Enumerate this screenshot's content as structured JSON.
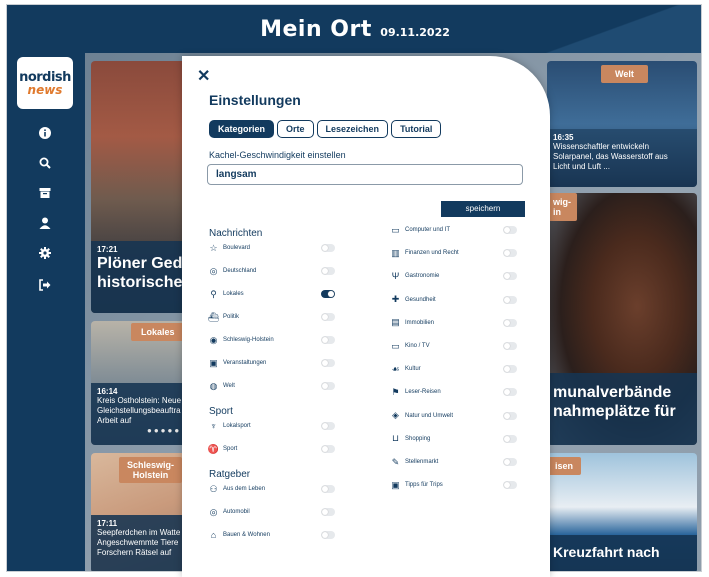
{
  "header": {
    "title": "Mein Ort",
    "date": "09.11.2022"
  },
  "logo": {
    "line1": "nordish",
    "line2": "news"
  },
  "sidebar": {
    "icons": [
      "info-icon",
      "search-icon",
      "archive-icon",
      "user-icon",
      "gear-icon",
      "logout-icon"
    ]
  },
  "tiles": {
    "main": {
      "time": "17:21",
      "headline_line1": "Plöner Ged",
      "headline_line2": "historische"
    },
    "lokales": {
      "category": "Lokales",
      "time": "16:14",
      "text_line1": "Kreis Ostholstein: Neue",
      "text_line2": "Gleichstellungsbeauftra",
      "text_line3": "Arbeit auf"
    },
    "schleswig": {
      "category_line1": "Schleswig-",
      "category_line2": "Holstein",
      "time": "17:11",
      "text_line1": "Seepferdchen im Watte",
      "text_line2": "Angeschwemmte Tiere",
      "text_line3": "Forschern Rätsel auf"
    },
    "welt": {
      "category": "Welt",
      "time": "16:35",
      "text_line1": "Wissenschaftler entwickeln",
      "text_line2": "Solarpanel, das Wasserstoff aus",
      "text_line3": "Licht und Luft ..."
    },
    "woman": {
      "category_line1": "wig-",
      "category_line2": "in",
      "headline_line1": "munalverbände",
      "headline_line2": "nahmeplätze für"
    },
    "ship": {
      "category": "isen",
      "headline": "Kreuzfahrt nach"
    }
  },
  "modal": {
    "close": "✕",
    "title": "Einstellungen",
    "tabs": [
      "Kategorien",
      "Orte",
      "Lesezeichen",
      "Tutorial"
    ],
    "speed_label": "Kachel-Geschwindigkeit einstellen",
    "speed_value": "langsam",
    "save_label": "speichern",
    "left_groups": [
      {
        "title": "Nachrichten",
        "items": [
          {
            "icon": "star-icon",
            "label": "Boulevard",
            "on": false
          },
          {
            "icon": "de-icon",
            "label": "Deutschland",
            "on": false
          },
          {
            "icon": "pin-icon",
            "label": "Lokales",
            "on": true
          },
          {
            "icon": "ship-icon",
            "label": "Politik",
            "on": false
          },
          {
            "icon": "sh-icon",
            "label": "Schleswig-Holstein",
            "on": false
          },
          {
            "icon": "calendar-icon",
            "label": "Veranstaltungen",
            "on": false
          },
          {
            "icon": "globe-icon",
            "label": "Welt",
            "on": false
          }
        ]
      },
      {
        "title": "Sport",
        "items": [
          {
            "icon": "trophy-icon",
            "label": "Lokalsport",
            "on": false
          },
          {
            "icon": "cup-icon",
            "label": "Sport",
            "on": false
          }
        ]
      },
      {
        "title": "Ratgeber",
        "items": [
          {
            "icon": "people-icon",
            "label": "Aus dem Leben",
            "on": false
          },
          {
            "icon": "wheel-icon",
            "label": "Automobil",
            "on": false
          },
          {
            "icon": "house-icon",
            "label": "Bauen & Wohnen",
            "on": false
          }
        ]
      }
    ],
    "right_items": [
      {
        "icon": "monitor-icon",
        "label": "Computer und IT",
        "on": false
      },
      {
        "icon": "chart-icon",
        "label": "Finanzen und Recht",
        "on": false
      },
      {
        "icon": "cutlery-icon",
        "label": "Gastronomie",
        "on": false
      },
      {
        "icon": "cross-icon",
        "label": "Gesundheit",
        "on": false
      },
      {
        "icon": "building-icon",
        "label": "Immobilien",
        "on": false
      },
      {
        "icon": "tv-icon",
        "label": "Kino / TV",
        "on": false
      },
      {
        "icon": "culture-icon",
        "label": "Kultur",
        "on": false
      },
      {
        "icon": "reader-icon",
        "label": "Leser-Reisen",
        "on": false
      },
      {
        "icon": "leaf-icon",
        "label": "Natur und Umwelt",
        "on": false
      },
      {
        "icon": "cart-icon",
        "label": "Shopping",
        "on": false
      },
      {
        "icon": "pen-icon",
        "label": "Stellenmarkt",
        "on": false
      },
      {
        "icon": "suitcase-icon",
        "label": "Tipps für Trips",
        "on": false
      }
    ]
  }
}
